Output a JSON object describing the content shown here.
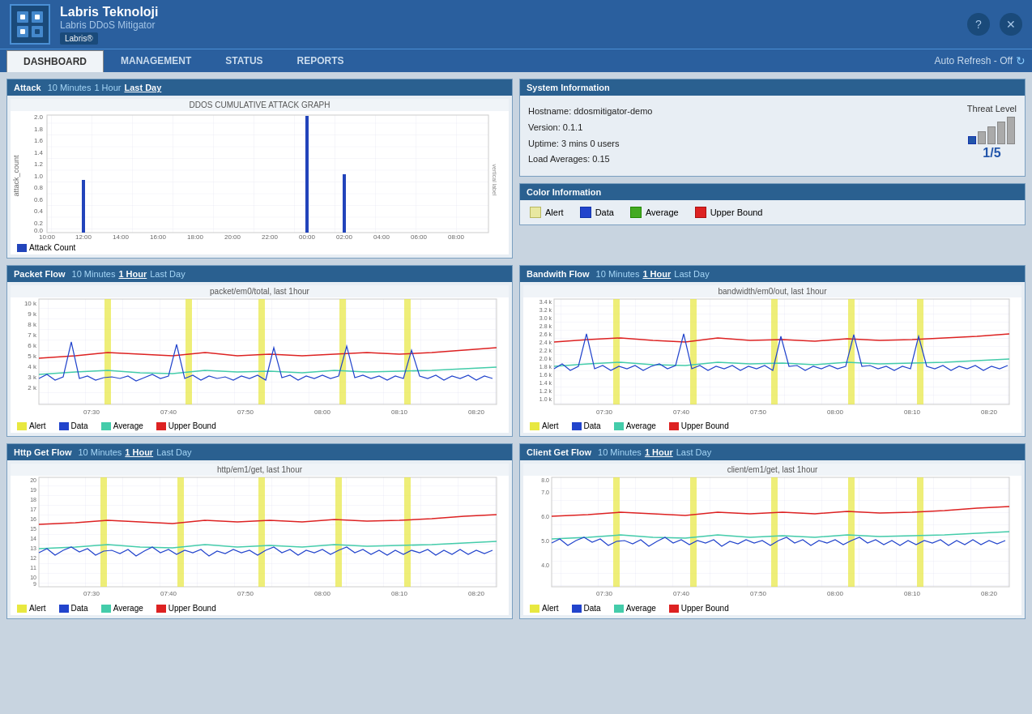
{
  "header": {
    "company": "Labris Teknoloji",
    "product": "Labris DDoS Mitigator",
    "badge": "Labris®",
    "icons": [
      "?",
      "x"
    ]
  },
  "nav": {
    "items": [
      "DASHBOARD",
      "MANAGEMENT",
      "STATUS",
      "REPORTS"
    ],
    "active": "DASHBOARD",
    "auto_refresh": "Auto Refresh - Off"
  },
  "attack_panel": {
    "title": "Attack",
    "tabs": [
      "10 Minutes",
      "1 Hour",
      "Last Day"
    ],
    "active_tab": "Last Day",
    "chart_title": "DDOS CUMULATIVE ATTACK GRAPH",
    "y_label": "attack_count",
    "y_ticks": [
      "2.0",
      "1.8",
      "1.6",
      "1.4",
      "1.2",
      "1.0",
      "0.8",
      "0.6",
      "0.4",
      "0.2",
      "0.0"
    ],
    "x_ticks": [
      "10:00",
      "12:00",
      "14:00",
      "16:00",
      "18:00",
      "20:00",
      "22:00",
      "00:00",
      "02:00",
      "04:00",
      "06:00",
      "08:00"
    ],
    "legend": [
      {
        "color": "#2244bb",
        "label": "Attack Count"
      }
    ]
  },
  "sysinfo_panel": {
    "title": "System Information",
    "hostname": "Hostname: ddosmitigator-demo",
    "version": "Version: 0.1.1",
    "uptime": "Uptime: 3 mins 0 users",
    "load": "Load Averages: 0.15",
    "threat_label": "Threat Level",
    "threat_value": "1/5",
    "threat_bars": [
      1,
      2,
      3,
      4,
      5
    ],
    "threat_active": 1
  },
  "color_info_panel": {
    "title": "Color Information",
    "items": [
      {
        "color": "#e8e8a0",
        "border": "#b8b860",
        "label": "Alert"
      },
      {
        "color": "#2244cc",
        "border": "#1133aa",
        "label": "Data"
      },
      {
        "color": "#44aa22",
        "border": "#228800",
        "label": "Average"
      },
      {
        "color": "#dd2222",
        "border": "#aa1111",
        "label": "Upper Bound"
      }
    ]
  },
  "packet_flow_panel": {
    "title": "Packet Flow",
    "tabs": [
      "10 Minutes",
      "1 Hour",
      "Last Day"
    ],
    "active_tab": "1 Hour",
    "chart_title": "packet/em0/total, last 1hour",
    "legend": [
      {
        "color": "#e8e840",
        "label": "Alert"
      },
      {
        "color": "#2244cc",
        "label": "Data"
      },
      {
        "color": "#44ccaa",
        "label": "Average"
      },
      {
        "color": "#dd2222",
        "label": "Upper Bound"
      }
    ]
  },
  "bandwidth_flow_panel": {
    "title": "Bandwith Flow",
    "tabs": [
      "10 Minutes",
      "1 Hour",
      "Last Day"
    ],
    "active_tab": "1 Hour",
    "chart_title": "bandwidth/em0/out, last 1hour",
    "legend": [
      {
        "color": "#e8e840",
        "label": "Alert"
      },
      {
        "color": "#2244cc",
        "label": "Data"
      },
      {
        "color": "#44ccaa",
        "label": "Average"
      },
      {
        "color": "#dd2222",
        "label": "Upper Bound"
      }
    ]
  },
  "http_get_flow_panel": {
    "title": "Http Get Flow",
    "tabs": [
      "10 Minutes",
      "1 Hour",
      "Last Day"
    ],
    "active_tab": "1 Hour",
    "chart_title": "http/em1/get, last 1hour",
    "legend": [
      {
        "color": "#e8e840",
        "label": "Alert"
      },
      {
        "color": "#2244cc",
        "label": "Data"
      },
      {
        "color": "#44ccaa",
        "label": "Average"
      },
      {
        "color": "#dd2222",
        "label": "Upper Bound"
      }
    ]
  },
  "client_get_flow_panel": {
    "title": "Client Get Flow",
    "tabs": [
      "10 Minutes",
      "1 Hour",
      "Last Day"
    ],
    "active_tab": "1 Hour",
    "chart_title": "client/em1/get, last 1hour",
    "legend": [
      {
        "color": "#e8e840",
        "label": "Alert"
      },
      {
        "color": "#2244cc",
        "label": "Data"
      },
      {
        "color": "#44ccaa",
        "label": "Average"
      },
      {
        "color": "#dd2222",
        "label": "Upper Bound"
      }
    ]
  },
  "x_ticks_flow": [
    "07:30",
    "07:40",
    "07:50",
    "08:00",
    "08:10",
    "08:20"
  ]
}
